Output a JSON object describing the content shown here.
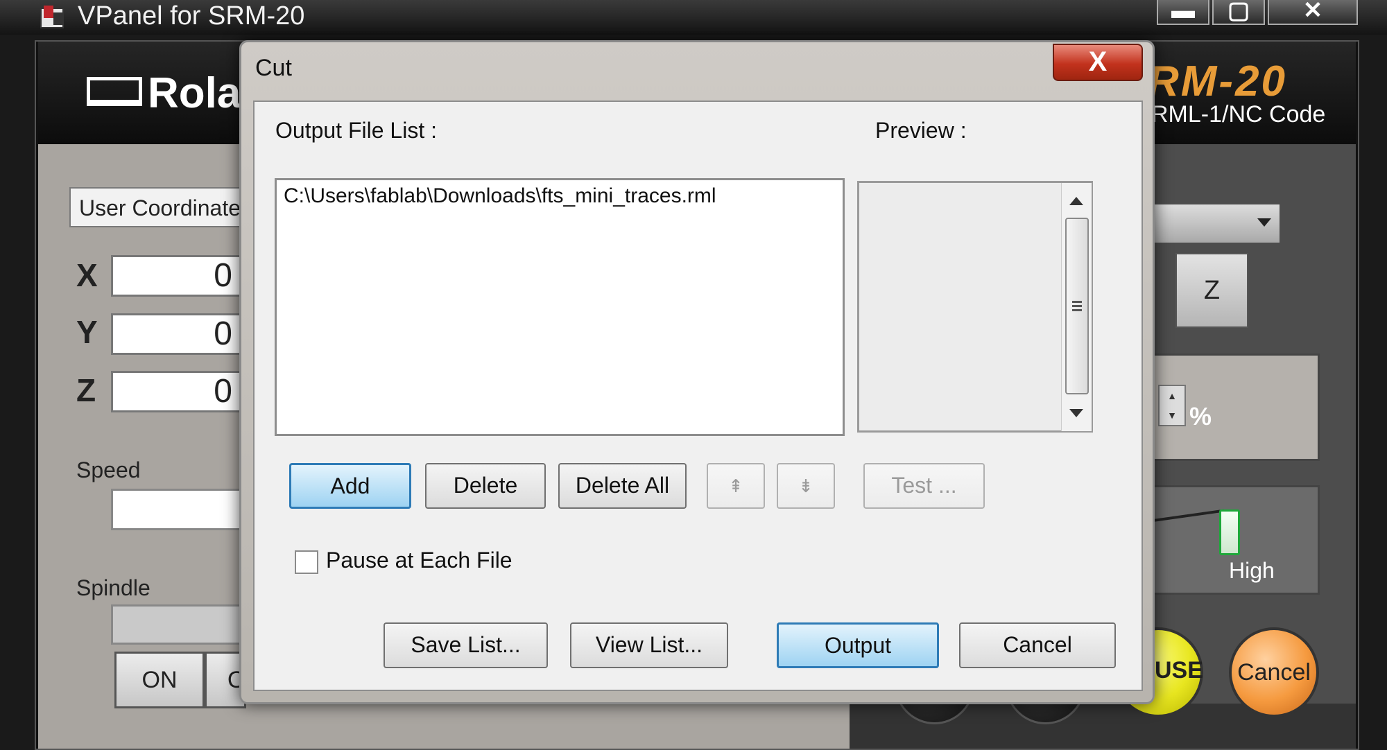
{
  "app": {
    "title": "VPanel for SRM-20",
    "brand": "Rola",
    "model": "RM-20",
    "model_sub": "RML-1/NC Code",
    "window_controls": {
      "minimize": "▬",
      "maximize": "▢",
      "close": "✕"
    }
  },
  "background_panel": {
    "coord_system": "User Coordinate S",
    "axes": [
      {
        "label": "X",
        "value": "0"
      },
      {
        "label": "Y",
        "value": "0"
      },
      {
        "label": "Z",
        "value": "0"
      }
    ],
    "speed_label": "Speed",
    "spindle_label": "Spindle",
    "on_label": "ON",
    "off_label": "OFF",
    "z_button": "Z",
    "percent": "%",
    "high_label": "High",
    "pause_label": "USE",
    "cancel_label": "Cancel"
  },
  "dialog": {
    "title": "Cut",
    "close_label": "X",
    "output_list_label": "Output File List :",
    "preview_label": "Preview :",
    "files": [
      "C:\\Users\\fablab\\Downloads\\fts_mini_traces.rml"
    ],
    "buttons": {
      "add": "Add",
      "delete": "Delete",
      "delete_all": "Delete All",
      "move_up": "⇞",
      "move_down": "⇟",
      "test": "Test ...",
      "save_list": "Save List...",
      "view_list": "View List...",
      "output": "Output",
      "cancel": "Cancel"
    },
    "pause_checkbox_label": "Pause at Each File",
    "pause_checked": false
  },
  "colors": {
    "accent_blue": "#2e7bb6",
    "close_red": "#c2321d",
    "model_orange": "#e89c38",
    "pause_yellow": "#e8e620",
    "cancel_orange": "#f59a3f"
  }
}
